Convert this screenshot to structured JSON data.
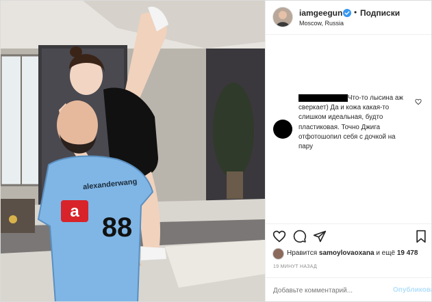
{
  "header": {
    "username": "iamgeegun",
    "separator": "•",
    "follow_label": "Подписки",
    "location": "Moscow, Russia"
  },
  "photo": {
    "jersey_text": "alexanderwang",
    "jersey_number": "88",
    "jersey_letter": "a"
  },
  "comment": {
    "text": "Что-то лысина аж сверкает) Да и кожа какая-то слишком идеальная, будто пластиковая. Точно Джига отфотошопил себя с дочкой на пару"
  },
  "likes": {
    "prefix": "Нравится",
    "user": "samoylovaoxana",
    "middle": "и ещё",
    "count": "19 478"
  },
  "timestamp": "19 МИНУТ НАЗАД",
  "add_comment": {
    "placeholder": "Добавьте комментарий...",
    "publish_label": "Опубликовать"
  },
  "colors": {
    "verified": "#3897f0",
    "publish_disabled": "#b2dffc",
    "jersey": "#7fb6e6"
  },
  "icons": [
    "verified-badge-icon",
    "heart-icon",
    "comment-icon",
    "share-icon",
    "bookmark-icon"
  ]
}
